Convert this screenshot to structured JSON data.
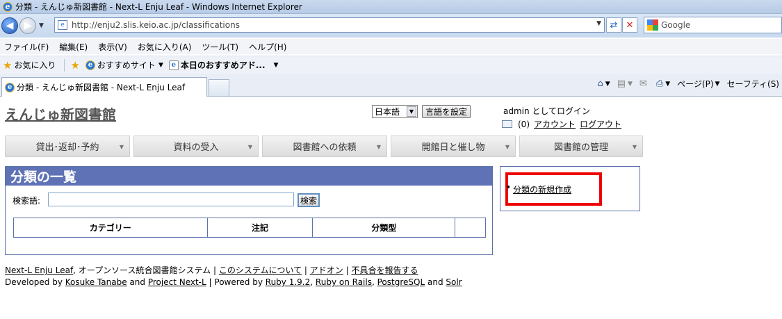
{
  "window": {
    "title": "分類 - えんじゅ新図書館 - Next-L Enju Leaf - Windows Internet Explorer"
  },
  "address": {
    "url": "http://enju2.slis.keio.ac.jp/classifications",
    "search_engine": "Google"
  },
  "menu": [
    "ファイル(F)",
    "編集(E)",
    "表示(V)",
    "お気に入り(A)",
    "ツール(T)",
    "ヘルプ(H)"
  ],
  "favorites": {
    "favorites_label": "お気に入り",
    "suggested_sites": "おすすめサイト",
    "today_addons": "本日のおすすめアド..."
  },
  "tab": {
    "active_title": "分類 - えんじゅ新図書館 - Next-L Enju Leaf"
  },
  "command_bar": {
    "page": "ページ(P)",
    "safety": "セーフティ(S)"
  },
  "site": {
    "title": "えんじゅ新図書館",
    "language_selected": "日本語",
    "language_button": "言語を設定",
    "login_text": "admin としてログイン",
    "message_count": "(0)",
    "account_link": "アカウント",
    "logout_link": "ログアウト"
  },
  "nav": [
    "貸出･返却･予約",
    "資料の受入",
    "図書館への依頼",
    "開館日と催し物",
    "図書館の管理"
  ],
  "main": {
    "heading": "分類の一覧",
    "search_label": "検索語:",
    "search_value": "",
    "search_button": "検索",
    "columns": [
      "カテゴリー",
      "注記",
      "分類型",
      ""
    ]
  },
  "sidebar": {
    "new_link": "分類の新規作成"
  },
  "footer": {
    "product": "Next-L Enju Leaf",
    "tagline": ", オープンソース統合図書館システム",
    "about": "このシステムについて",
    "addons": "アドオン",
    "report": "不具合を報告する",
    "developed_by": "Developed by",
    "author": "Kosuke Tanabe",
    "and1": "and",
    "project": "Project Next-L",
    "powered_by": "| Powered by",
    "ruby": "Ruby 1.9.2",
    "rails": "Ruby on Rails",
    "postgres": "PostgreSQL",
    "and2": "and",
    "solr": "Solr"
  },
  "colors": {
    "heading_bg": "#5e72b5",
    "highlight": "#ee0000"
  }
}
